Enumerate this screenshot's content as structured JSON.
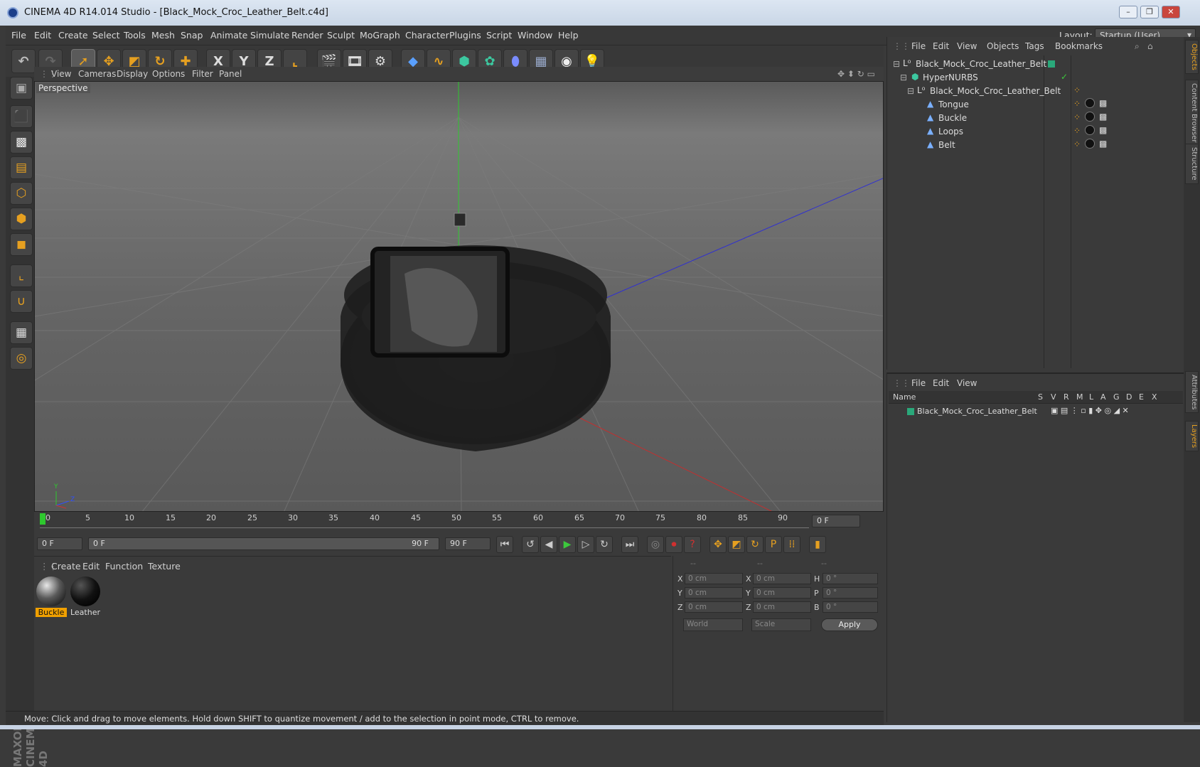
{
  "window": {
    "title": "CINEMA 4D R14.014 Studio - [Black_Mock_Croc_Leather_Belt.c4d]",
    "minimize": "–",
    "restore": "❐",
    "close": "✕"
  },
  "menubar": {
    "items": [
      "File",
      "Edit",
      "Create",
      "Select",
      "Tools",
      "Mesh",
      "Snap",
      "Animate",
      "Simulate",
      "Render",
      "Sculpt",
      "MoGraph",
      "Character",
      "Plugins",
      "Script",
      "Window",
      "Help"
    ],
    "layout_label": "Layout:",
    "layout_value": "Startup (User)"
  },
  "toolbar": {
    "icons": [
      "undo-icon",
      "redo-icon",
      "live-selection-icon",
      "move-icon",
      "scale-icon",
      "rotate-icon",
      "add-icon",
      "x-axis-icon",
      "y-axis-icon",
      "z-axis-icon",
      "coordinate-system-icon",
      "render-view-icon",
      "render-picture-viewer-icon",
      "edit-render-settings-icon",
      "cube-icon",
      "spline-icon",
      "nurbs-icon",
      "array-icon",
      "deformer-icon",
      "floor-icon",
      "camera-icon",
      "light-icon"
    ],
    "axis_labels": [
      "X",
      "Y",
      "Z"
    ]
  },
  "viewport": {
    "menu": [
      "View",
      "Cameras",
      "Display",
      "Options",
      "Filter",
      "Panel"
    ],
    "label": "Perspective",
    "axis_y": "Y",
    "axis_z": "Z"
  },
  "timeline": {
    "ticks": [
      "0",
      "5",
      "10",
      "15",
      "20",
      "25",
      "30",
      "35",
      "40",
      "45",
      "50",
      "55",
      "60",
      "65",
      "70",
      "75",
      "80",
      "85",
      "90"
    ],
    "current_frame": "0 F",
    "start_frame": "0 F",
    "range_start": "0 F",
    "range_end": "90 F",
    "end_frame": "90 F"
  },
  "material_manager": {
    "menu": [
      "Create",
      "Edit",
      "Function",
      "Texture"
    ],
    "materials": [
      {
        "name": "Buckle",
        "selected": true
      },
      {
        "name": "Leather",
        "selected": false
      }
    ]
  },
  "coordinates": {
    "headers": [
      "--",
      "--",
      "--"
    ],
    "rows": [
      {
        "a": "X",
        "a_val": "0 cm",
        "b": "X",
        "b_val": "0 cm",
        "c": "H",
        "c_val": "0 °"
      },
      {
        "a": "Y",
        "a_val": "0 cm",
        "b": "Y",
        "b_val": "0 cm",
        "c": "P",
        "c_val": "0 °"
      },
      {
        "a": "Z",
        "a_val": "0 cm",
        "b": "Z",
        "b_val": "0 cm",
        "c": "B",
        "c_val": "0 °"
      }
    ],
    "mode1": "World",
    "mode2": "Scale",
    "apply": "Apply"
  },
  "status": "Move: Click and drag to move elements. Hold down SHIFT to quantize movement / add to the selection in point mode, CTRL to remove.",
  "object_manager": {
    "menu": [
      "File",
      "Edit",
      "View",
      "Objects",
      "Tags",
      "Bookmarks"
    ],
    "objects": [
      {
        "name": "Black_Mock_Croc_Leather_Belt",
        "icon": "null-icon",
        "indent": 0
      },
      {
        "name": "HyperNURBS",
        "icon": "hypernurbs-icon",
        "indent": 1
      },
      {
        "name": "Black_Mock_Croc_Leather_Belt",
        "icon": "null-icon",
        "indent": 2
      },
      {
        "name": "Tongue",
        "icon": "polygon-object-icon",
        "indent": 3
      },
      {
        "name": "Buckle",
        "icon": "polygon-object-icon",
        "indent": 3
      },
      {
        "name": "Loops",
        "icon": "polygon-object-icon",
        "indent": 3
      },
      {
        "name": "Belt",
        "icon": "polygon-object-icon",
        "indent": 3
      }
    ]
  },
  "layer_manager": {
    "menu": [
      "File",
      "Edit",
      "View"
    ],
    "columns": [
      "Name",
      "S",
      "V",
      "R",
      "M",
      "L",
      "A",
      "G",
      "D",
      "E",
      "X"
    ],
    "layers": [
      {
        "name": "Black_Mock_Croc_Leather_Belt",
        "color": "#2aa87a"
      }
    ]
  },
  "side_tabs": [
    "Objects",
    "Content Browser",
    "Structure",
    "Attributes",
    "Layers"
  ],
  "brand": "MAXON CINEMA 4D",
  "colors": {
    "accent": "#e6a020",
    "selection": "#f0a000",
    "play": "#3cc83c"
  }
}
